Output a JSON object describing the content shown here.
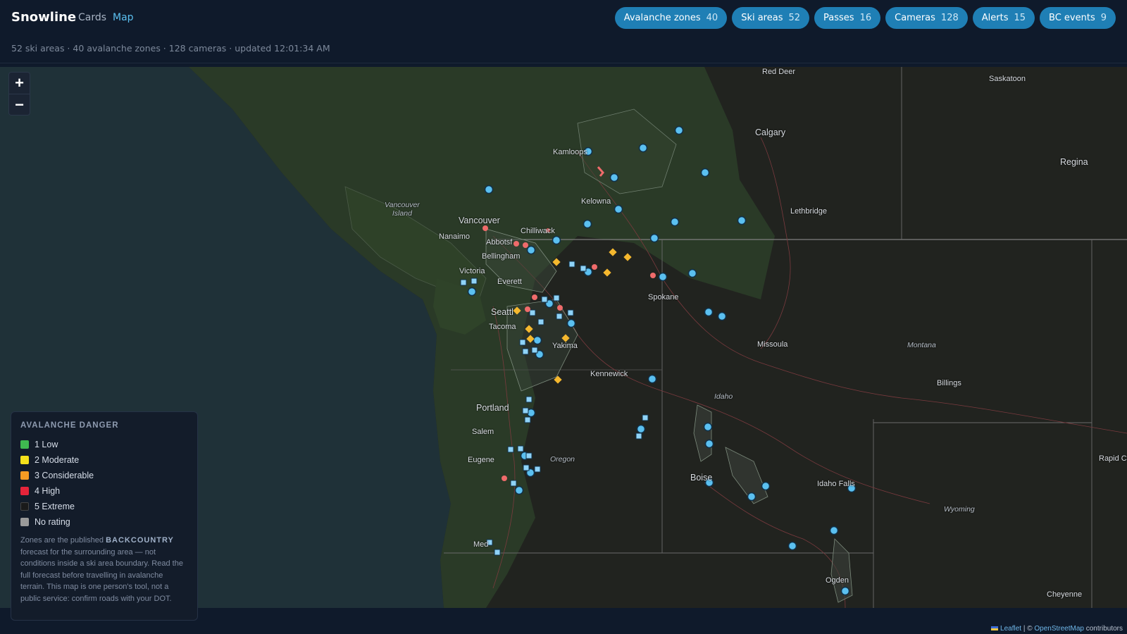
{
  "app": {
    "brand": "Snowline"
  },
  "nav": {
    "cards": "Cards",
    "map": "Map"
  },
  "pills": [
    {
      "label": "Avalanche zones",
      "count": "40"
    },
    {
      "label": "Ski areas",
      "count": "52"
    },
    {
      "label": "Passes",
      "count": "16"
    },
    {
      "label": "Cameras",
      "count": "128"
    },
    {
      "label": "Alerts",
      "count": "15"
    },
    {
      "label": "BC events",
      "count": "9"
    }
  ],
  "subline": "52 ski areas · 40 avalanche zones · 128 cameras · updated 12:01:34 AM",
  "zoom": {
    "in": "+",
    "out": "−"
  },
  "legend": {
    "title": "AVALANCHE DANGER",
    "items": [
      {
        "label": "1 Low",
        "color": "#3fb950"
      },
      {
        "label": "2 Moderate",
        "color": "#f5e11b"
      },
      {
        "label": "3 Considerable",
        "color": "#f59b23"
      },
      {
        "label": "4 High",
        "color": "#e5243a"
      },
      {
        "label": "5 Extreme",
        "color": "#1a1a1a"
      },
      {
        "label": "No rating",
        "color": "#9a9a9a"
      }
    ],
    "note_pre": "Zones are the published",
    "note_strong": "BACKCOUNTRY",
    "note_post": "forecast for the surrounding area — not conditions inside a ski area boundary. Read the full forecast before travelling in avalanche terrain. This map is one person's tool, not a public service: confirm roads with your DOT."
  },
  "attribution": {
    "leaflet": "Leaflet",
    "sep": " | © ",
    "osm": "OpenStreetMap",
    "suffix": " contributors"
  },
  "map_labels": {
    "red_deer": "Red Deer",
    "saskatoon": "Saskatoon",
    "calgary": "Calgary",
    "regina": "Regina",
    "kamloops": "Kamloops",
    "kelowna": "Kelowna",
    "lethbridge": "Lethbridge",
    "vancouver_island": "Vancouver\nIsland",
    "vancouver": "Vancouver",
    "nanaimo": "Nanaimo",
    "chilliwack": "Chilliwack",
    "abbotsford": "Abbotsf",
    "bellingham": "Bellingham",
    "victoria": "Victoria",
    "everett": "Everett",
    "seattle": "Seattl",
    "tacoma": "Tacoma",
    "spokane": "Spokane",
    "yakima": "Yakima",
    "missoula": "Missoula",
    "montana": "Montana",
    "kennewick": "Kennewick",
    "billings": "Billings",
    "portland": "Portland",
    "idaho": "Idaho",
    "salem": "Salem",
    "eugene": "Eugene",
    "oregon": "Oregon",
    "boise": "Boise",
    "idaho_falls": "Idaho Falls",
    "rapid_city": "Rapid Ci",
    "wyoming": "Wyoming",
    "medford": "Med",
    "ogden": "Ogden",
    "cheyenne": "Cheyenne"
  },
  "colors": {
    "ski_marker": "#5bc0f0",
    "camera_marker": "#8fd3f7",
    "alert_marker": "#ef6b6b",
    "pass_marker": "#f5b82e",
    "pill_bg": "#1f7fb5",
    "accent": "#5bc0f0"
  }
}
